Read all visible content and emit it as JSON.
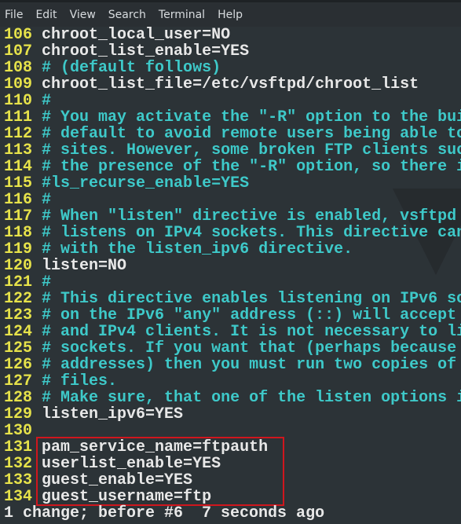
{
  "menu": [
    "File",
    "Edit",
    "View",
    "Search",
    "Terminal",
    "Help"
  ],
  "lines": [
    {
      "n": "106",
      "t": "chroot_local_user=NO",
      "c": false
    },
    {
      "n": "107",
      "t": "chroot_list_enable=YES",
      "c": false
    },
    {
      "n": "108",
      "t": "# (default follows)",
      "c": true
    },
    {
      "n": "109",
      "t": "chroot_list_file=/etc/vsftpd/chroot_list",
      "c": false
    },
    {
      "n": "110",
      "t": "#",
      "c": true
    },
    {
      "n": "111",
      "t": "# You may activate the \"-R\" option to the bui",
      "c": true
    },
    {
      "n": "112",
      "t": "# default to avoid remote users being able to",
      "c": true
    },
    {
      "n": "113",
      "t": "# sites. However, some broken FTP clients suc",
      "c": true
    },
    {
      "n": "114",
      "t": "# the presence of the \"-R\" option, so there i",
      "c": true
    },
    {
      "n": "115",
      "t": "#ls_recurse_enable=YES",
      "c": true
    },
    {
      "n": "116",
      "t": "#",
      "c": true
    },
    {
      "n": "117",
      "t": "# When \"listen\" directive is enabled, vsftpd",
      "c": true
    },
    {
      "n": "118",
      "t": "# listens on IPv4 sockets. This directive can",
      "c": true
    },
    {
      "n": "119",
      "t": "# with the listen_ipv6 directive.",
      "c": true
    },
    {
      "n": "120",
      "t": "listen=NO",
      "c": false
    },
    {
      "n": "121",
      "t": "#",
      "c": true
    },
    {
      "n": "122",
      "t": "# This directive enables listening on IPv6 so",
      "c": true
    },
    {
      "n": "123",
      "t": "# on the IPv6 \"any\" address (::) will accept",
      "c": true
    },
    {
      "n": "124",
      "t": "# and IPv4 clients. It is not necessary to li",
      "c": true
    },
    {
      "n": "125",
      "t": "# sockets. If you want that (perhaps because",
      "c": true
    },
    {
      "n": "126",
      "t": "# addresses) then you must run two copies of",
      "c": true
    },
    {
      "n": "127",
      "t": "# files.",
      "c": true
    },
    {
      "n": "128",
      "t": "# Make sure, that one of the listen options i",
      "c": true
    },
    {
      "n": "129",
      "t": "listen_ipv6=YES",
      "c": false
    },
    {
      "n": "130",
      "t": "",
      "c": false
    },
    {
      "n": "131",
      "t": "pam_service_name=ftpauth",
      "c": false
    },
    {
      "n": "132",
      "t": "userlist_enable=YES",
      "c": false
    },
    {
      "n": "133",
      "t": "guest_enable=YES",
      "c": false
    },
    {
      "n": "134",
      "t": "guest_username=ftp",
      "c": false
    }
  ],
  "status": "1 change; before #6  7 seconds ago",
  "colors": {
    "background": "#2c3337",
    "line_number": "#e6e24a",
    "comment": "#3ec9c9",
    "text": "#e8e8e8",
    "highlight_box": "#d0161d"
  }
}
